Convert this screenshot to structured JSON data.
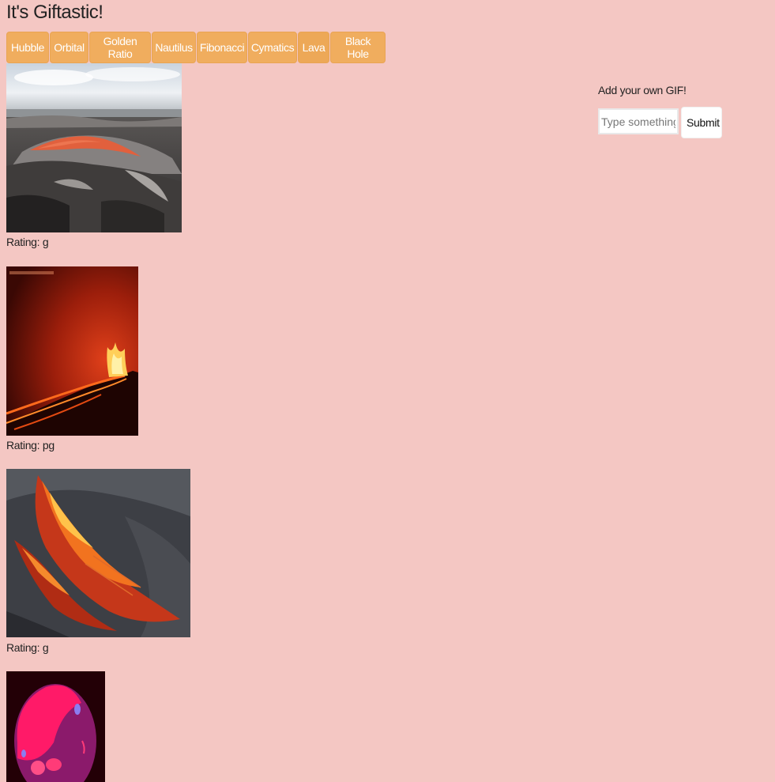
{
  "page": {
    "title": "It's Giftastic!",
    "background_color": "#f4c7c3",
    "button_color": "#f0ad5e"
  },
  "topics": [
    {
      "label": "Hubble",
      "active": false
    },
    {
      "label": "Orbital",
      "active": false
    },
    {
      "label": "Golden Ratio",
      "active": false
    },
    {
      "label": "Nautilus",
      "active": false
    },
    {
      "label": "Fibonacci",
      "active": false
    },
    {
      "label": "Cymatics",
      "active": false
    },
    {
      "label": "Lava",
      "active": true
    },
    {
      "label": "Black Hole",
      "active": false
    }
  ],
  "gifs": [
    {
      "subject": "lava-flow-landscape",
      "rating": "Rating: g"
    },
    {
      "subject": "lava-fountain-night",
      "rating": "Rating: pg"
    },
    {
      "subject": "pahoehoe-lava-closeup",
      "rating": "Rating: g"
    },
    {
      "subject": "pink-lava-lamp-blob",
      "rating": ""
    }
  ],
  "add_gif": {
    "label": "Add your own GIF!",
    "input_value": "",
    "input_placeholder": "Type something...",
    "submit_label": "Submit"
  }
}
